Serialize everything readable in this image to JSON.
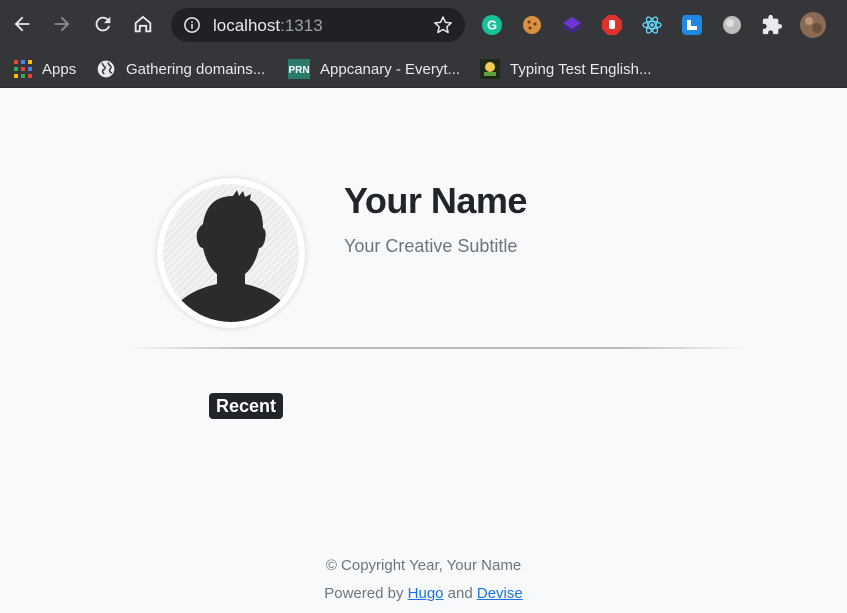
{
  "browser": {
    "url_host": "localhost",
    "url_port": ":1313",
    "icons": {
      "back": "arrow-left-icon",
      "forward": "arrow-right-icon",
      "reload": "reload-icon",
      "home": "home-icon",
      "site_info": "info-icon",
      "bookmark_star": "star-icon"
    },
    "extensions": [
      {
        "name": "grammarly-extension-icon",
        "letter": "G",
        "color": "#15c39a"
      },
      {
        "name": "cookie-extension-icon",
        "color": "#d9903f"
      },
      {
        "name": "layers-extension-icon",
        "color": "#6c35d9"
      },
      {
        "name": "stop-hand-extension-icon",
        "color": "#e0312d"
      },
      {
        "name": "react-devtools-extension-icon",
        "color": "#61dafb"
      },
      {
        "name": "blue-square-extension-icon",
        "color": "#1e88e5"
      },
      {
        "name": "globe-extension-icon",
        "color": "#9e9e9e"
      },
      {
        "name": "puzzle-extensions-icon",
        "color": "#e8eaed"
      },
      {
        "name": "profile-avatar-icon",
        "color": "#8a6a52"
      }
    ]
  },
  "bookmarks": [
    {
      "label": "Apps",
      "icon": "apps-grid-icon"
    },
    {
      "label": "Gathering domains...",
      "icon": "globe-icon"
    },
    {
      "label": "Appcanary - Everyt...",
      "icon": "prn-icon",
      "icon_text": "PRN"
    },
    {
      "label": "Typing Test English...",
      "icon": "typing-test-icon"
    }
  ],
  "profile": {
    "name": "Your Name",
    "subtitle": "Your Creative Subtitle",
    "avatar_icon": "person-silhouette-icon"
  },
  "tags": {
    "recent": "Recent"
  },
  "footer": {
    "copyright": "© Copyright Year, Your Name",
    "powered_prefix": "Powered by",
    "hugo": "Hugo",
    "and": "and",
    "devise": "Devise"
  },
  "colors": {
    "toolbar_bg": "#35363a",
    "page_bg": "#f8f9fa",
    "link": "#1a73e8"
  }
}
